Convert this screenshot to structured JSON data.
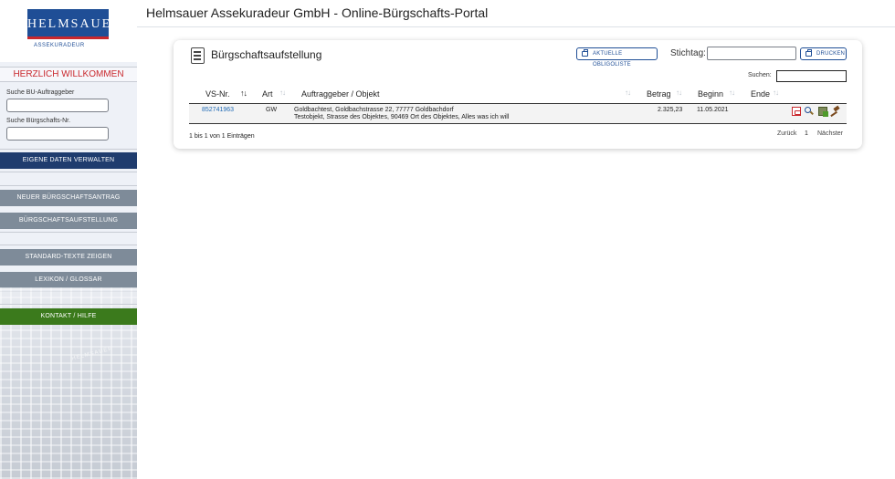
{
  "sidebar": {
    "logo_text": "HELMSAUER",
    "logo_sub": "ASSEKURADEUR",
    "welcome": "HERZLICH WILLKOMMEN",
    "search_bu_label": "Suche BU-Auftraggeber",
    "search_bu_value": "",
    "search_bue_label": "Suche Bürgschafts-Nr.",
    "search_bue_value": "",
    "nav": {
      "eigene_daten": "EIGENE DATEN VERWALTEN",
      "neuer_antrag": "NEUER BÜRGSCHAFTSANTRAG",
      "aufstellung": "BÜRGSCHAFTSAUFSTELLUNG",
      "standard_texte": "STANDARD-TEXTE ZEIGEN",
      "lexikon": "LEXIKON / GLOSSAR",
      "kontakt": "KONTAKT / HILFE"
    },
    "building_label": "HELMSAUER"
  },
  "header": {
    "title": "Helmsauer Assekuradeur GmbH - Online-Bürgschafts-Portal"
  },
  "card": {
    "title": "Bürgschaftsaufstellung",
    "btn_obligo": "AKTUELLE OBLIGOLISTE",
    "stichtag_label": "Stichtag:",
    "stichtag_value": "",
    "btn_drucken": "DRUCKEN",
    "suchen_label": "Suchen:",
    "suchen_value": "",
    "columns": {
      "vsnr": "VS-Nr.",
      "art": "Art",
      "auftraggeber": "Auftraggeber / Objekt",
      "betrag": "Betrag",
      "beginn": "Beginn",
      "ende": "Ende"
    },
    "rows": [
      {
        "vsnr": "852741963",
        "art": "GW",
        "auftraggeber": "Goldbachtest, Goldbachstrasse 22, 77777 Goldbachdorf",
        "objekt": "Testobjekt, Strasse des Objektes, 90469 Ort des Objektes, Alles was ich will",
        "betrag": "2.325,23",
        "beginn": "11.05.2021",
        "ende": ""
      }
    ],
    "entries_info": "1 bis 1 von 1 Einträgen",
    "pagination": {
      "prev": "Zurück",
      "current": "1",
      "next": "Nächster"
    }
  },
  "colors": {
    "brand_blue": "#1f4e96",
    "brand_red": "#c9282d",
    "nav_dark": "#1f3c6e",
    "nav_grey": "#7e8b99",
    "nav_green": "#3b7a1c"
  }
}
